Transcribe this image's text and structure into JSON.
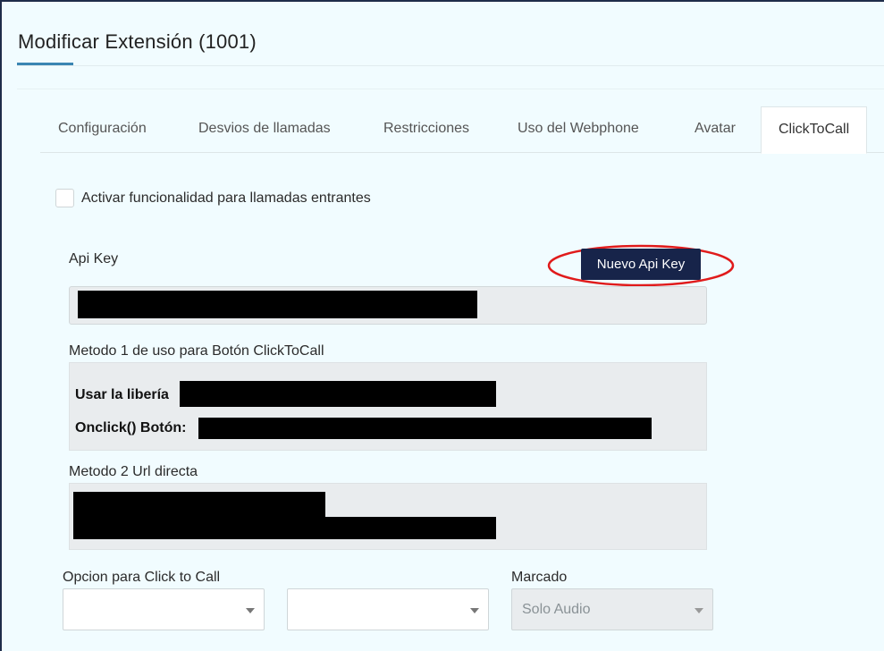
{
  "page": {
    "title": "Modificar Extensión (1001)"
  },
  "tabs": [
    {
      "label": "Configuración",
      "active": false
    },
    {
      "label": "Desvios de llamadas",
      "active": false
    },
    {
      "label": "Restricciones",
      "active": false
    },
    {
      "label": "Uso del Webphone",
      "active": false
    },
    {
      "label": "Avatar",
      "active": false
    },
    {
      "label": "ClickToCall",
      "active": true
    }
  ],
  "clicktocall": {
    "enable_incoming_label": "Activar funcionalidad para llamadas entrantes",
    "enable_incoming_checked": false,
    "api_key_label": "Api Key",
    "new_api_key_button": "Nuevo Api Key",
    "method1_label": "Metodo 1 de uso para Botón ClickToCall",
    "method1_library_label": "Usar la libería",
    "method1_onclick_label": "Onclick() Botón:",
    "method2_label": "Metodo 2 Url directa",
    "option_label": "Opcion para Click to Call",
    "option_select1_value": "",
    "option_select2_value": "",
    "dialing_label": "Marcado",
    "dialing_value": "Solo Audio"
  },
  "colors": {
    "background": "#f1fcff",
    "primary_button": "#17244a",
    "tab_underline": "#3a86b3",
    "highlight_ellipse": "#e01b1b"
  }
}
